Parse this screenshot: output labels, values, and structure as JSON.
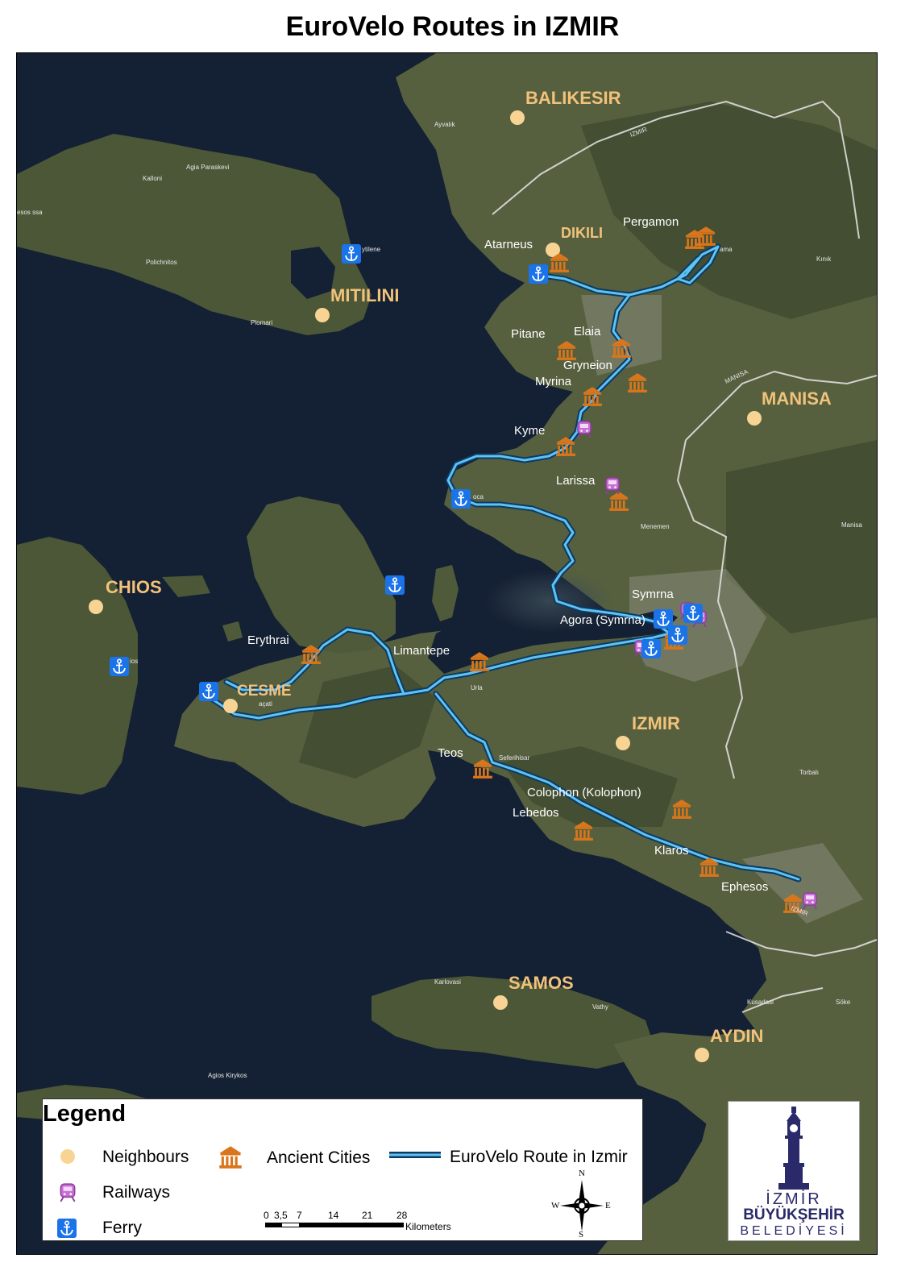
{
  "title": "EuroVelo Routes in IZMIR",
  "colors": {
    "sea": "#142033",
    "land": "#4a5a3a",
    "route_outer": "#0c3a66",
    "route_inner": "#5fc3f0",
    "neighbour": "#f7d493",
    "ancient": "#d9761c",
    "railway": "#c86fd6",
    "ferry": "#1a73e8",
    "label_major": "#f2c27a",
    "label_city": "#ffffff",
    "logo": "#2a2a6a"
  },
  "regions": {
    "balikesir": "BALIKESIR",
    "dikili": "DIKILI",
    "mitilini": "MITILINI",
    "manisa": "MANISA",
    "chios": "CHIOS",
    "cesme": "CESME",
    "izmir": "IZMIR",
    "samos": "SAMOS",
    "aydin": "AYDIN"
  },
  "ancient_cities": {
    "pergamon": "Pergamon",
    "atarneus": "Atarneus",
    "pitane": "Pitane",
    "elaia": "Elaia",
    "gryneion": "Gryneion",
    "myrina": "Myrina",
    "kyme": "Kyme",
    "larissa": "Larissa",
    "symrna": "Symrna",
    "agora": "Agora (Symrna)",
    "erythrai": "Erythrai",
    "limantepe": "Limantepe",
    "teos": "Teos",
    "colophon": "Colophon (Kolophon)",
    "lebedos": "Lebedos",
    "klaros": "Klaros",
    "ephesos": "Ephesos"
  },
  "small_places": {
    "ayvalik": "Ayvalık",
    "izmir_road_n": "IZMIR",
    "agia_paraskevi": "Agia Paraskevi",
    "kalloni": "Kalloni",
    "lesvos_w": "esos\nssa",
    "polichnitos": "Polichnitos",
    "plomari": "Plomari",
    "mytilene": "ytilene",
    "bergama": "ama",
    "kinik": "Kınık",
    "manisa_road": "MANISA",
    "foca": "oca",
    "menemen": "Menemen",
    "manisa_e": "Manisa",
    "chios_port": "ios",
    "alacati": "açati",
    "urla": "Urla",
    "seferihisar": "Seferihisar",
    "torbali": "Torbalı",
    "izmir_road_s": "IZMIR",
    "karlovasi": "Karlovasi",
    "vathy": "Vathy",
    "kusadasi": "Kusadasi",
    "soke": "Söke",
    "agios_kirykos": "Agios\nKirykos"
  },
  "legend": {
    "title": "Legend",
    "neighbours": "Neighbours",
    "railways": "Railways",
    "ferry": "Ferry",
    "ancient_cities": "Ancient Cities",
    "route": "EuroVelo Route in Izmir",
    "scale_ticks": [
      "0",
      "3,5",
      "7",
      "14",
      "21",
      "28"
    ],
    "scale_unit": "Kilometers",
    "compass": {
      "n": "N",
      "s": "S",
      "e": "E",
      "w": "W"
    }
  },
  "logo": {
    "line1": "İZMİR",
    "line2": "BÜYÜKŞEHİR",
    "line3": "BELEDİYESİ"
  },
  "icons": {
    "neighbour": "filled-circle-icon",
    "ancient": "temple-icon",
    "railway": "train-icon",
    "ferry": "anchor-icon"
  }
}
